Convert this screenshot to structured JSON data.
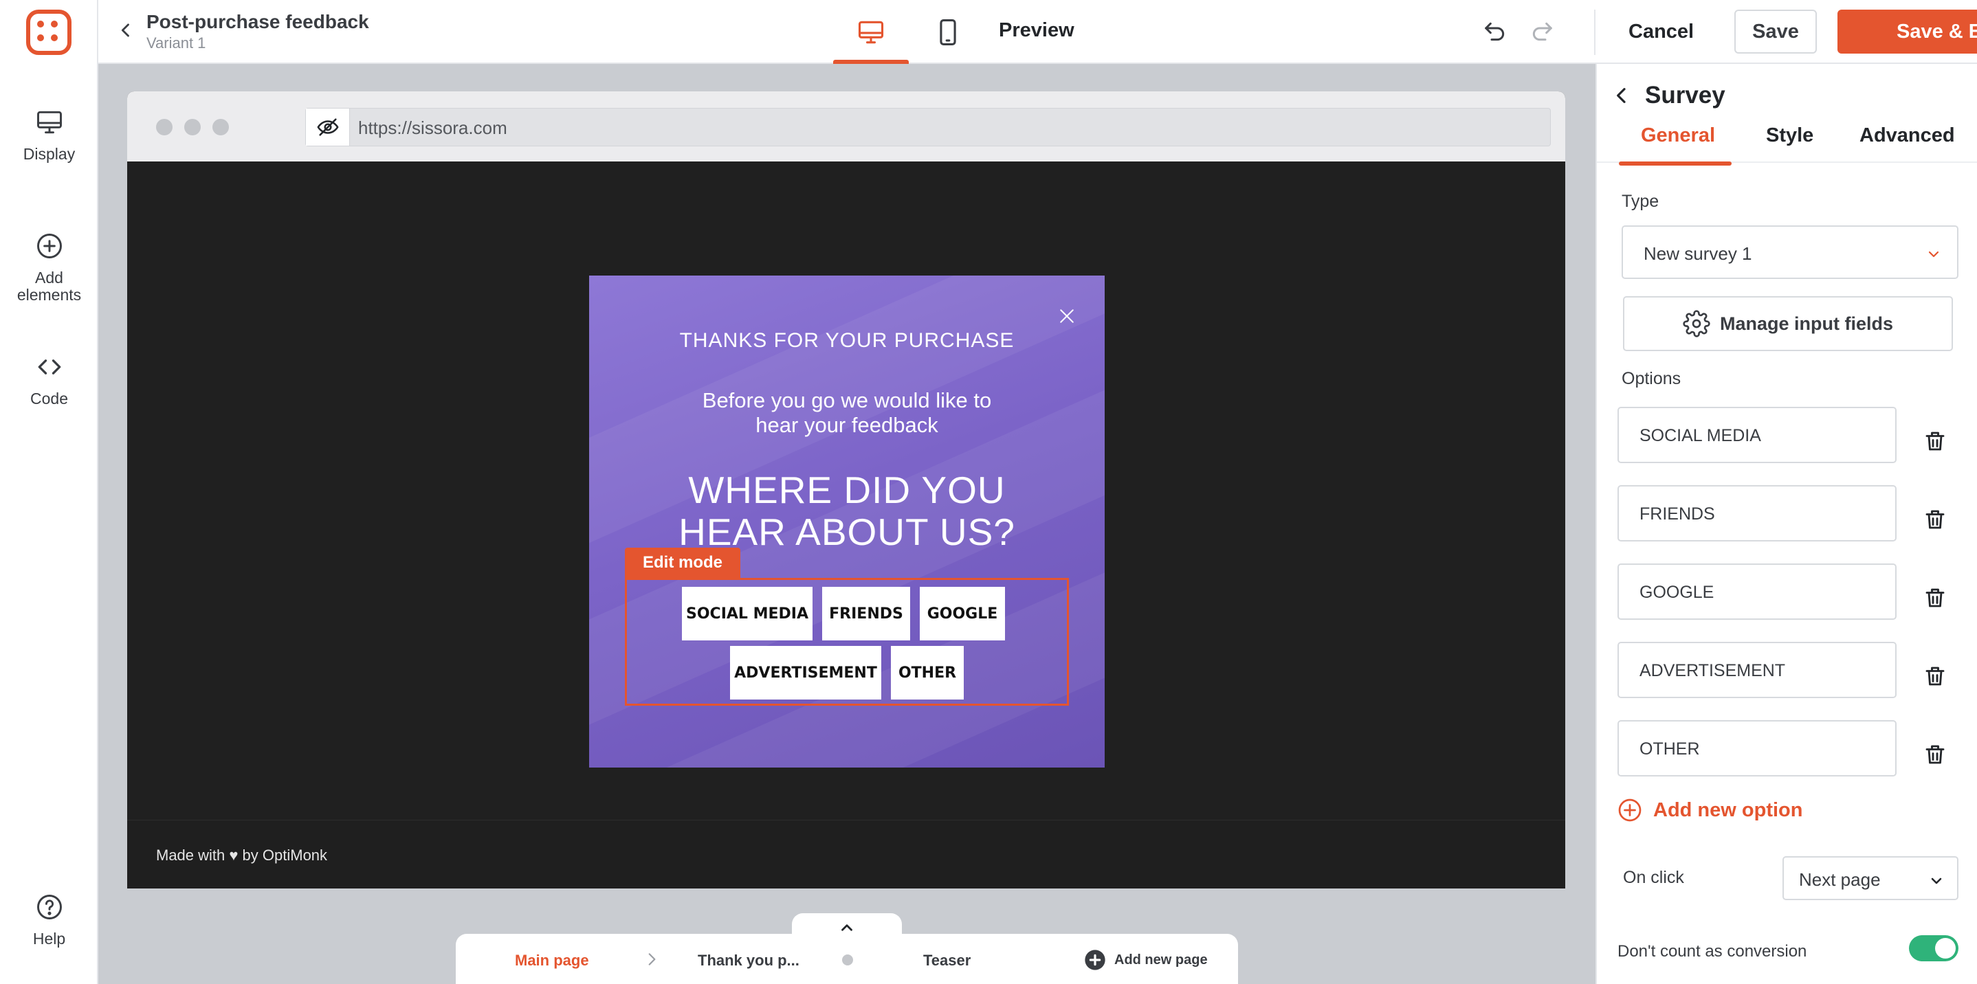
{
  "sidebar": {
    "items": [
      {
        "label": "Display",
        "icon": "monitor-icon"
      },
      {
        "label": "Add elements",
        "icon": "plus-circle-icon"
      },
      {
        "label": "Code",
        "icon": "code-icon"
      }
    ],
    "help": {
      "label": "Help",
      "icon": "help-circle-icon"
    }
  },
  "header": {
    "title": "Post-purchase feedback",
    "subtitle": "Variant 1",
    "preview_label": "Preview",
    "cancel_label": "Cancel",
    "save_label": "Save",
    "save_exit_label": "Save & Exit",
    "active_device": "desktop"
  },
  "browser": {
    "url": "https://sissora.com",
    "footer_text": "Made with ♥ by OptiMonk"
  },
  "popup": {
    "title": "THANKS FOR YOUR PURCHASE",
    "subtitle": "Before you go we would like to hear your feedback",
    "question": "WHERE DID YOU HEAR ABOUT US?",
    "edit_mode_label": "Edit mode",
    "options": [
      "SOCIAL MEDIA",
      "FRIENDS",
      "GOOGLE",
      "ADVERTISEMENT",
      "OTHER"
    ]
  },
  "pages": {
    "tabs": [
      {
        "label": "Main page",
        "active": true
      },
      {
        "label": "Thank you p...",
        "active": false
      },
      {
        "label": "Teaser",
        "active": false
      }
    ],
    "add_label": "Add new page"
  },
  "panel": {
    "title": "Survey",
    "tabs": [
      "General",
      "Style",
      "Advanced"
    ],
    "active_tab": "General",
    "type_label": "Type",
    "type_value": "New survey 1",
    "manage_label": "Manage input fields",
    "options_label": "Options",
    "options": [
      "SOCIAL MEDIA",
      "FRIENDS",
      "GOOGLE",
      "ADVERTISEMENT",
      "OTHER"
    ],
    "add_option_label": "Add new option",
    "on_click_label": "On click",
    "on_click_value": "Next page",
    "conversion_label": "Don't count as conversion",
    "conversion_toggle": true
  },
  "colors": {
    "accent": "#e4552f",
    "toggle_on": "#2fb37a",
    "popup_purple": "#7c64c8"
  }
}
